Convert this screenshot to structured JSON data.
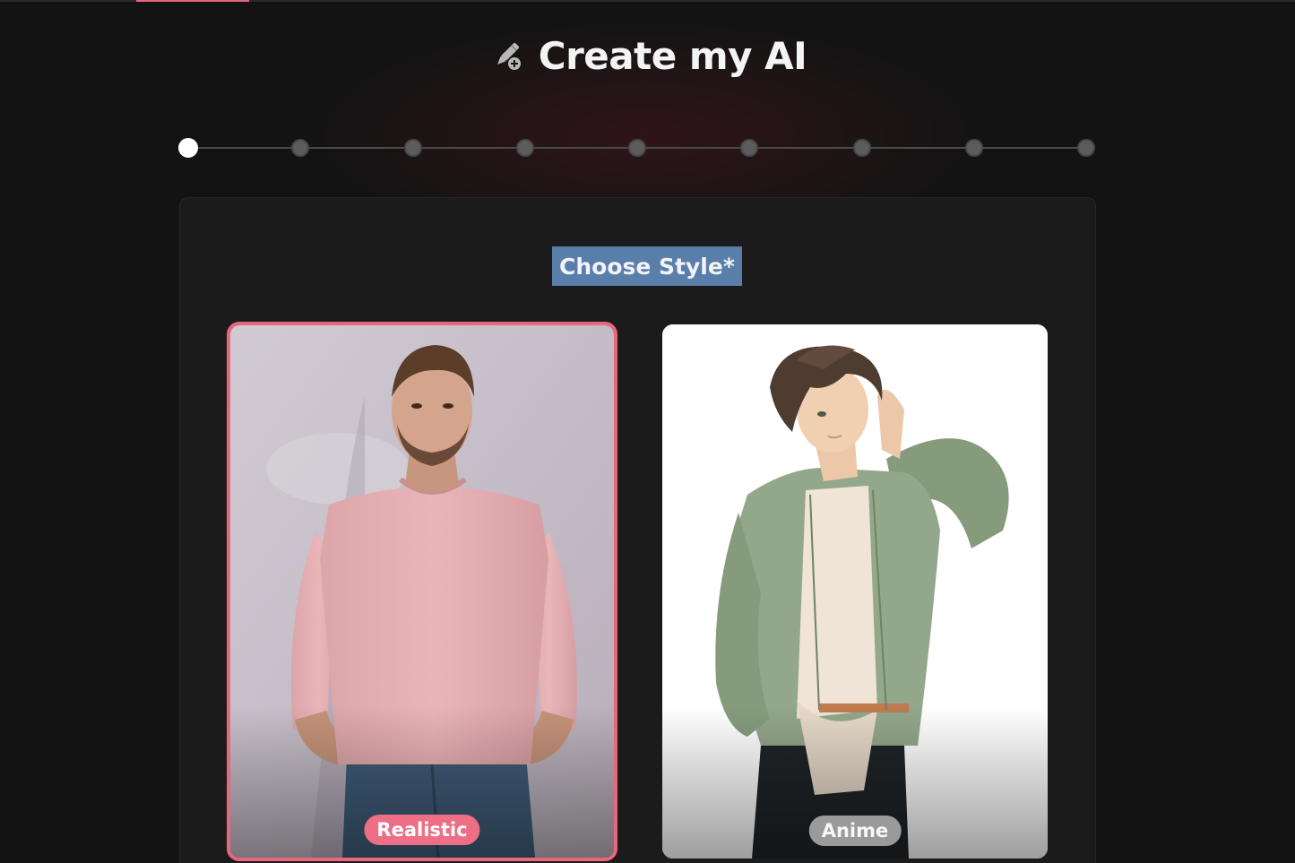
{
  "header": {
    "title": "Create my AI",
    "icon": "pen-plus-icon"
  },
  "stepper": {
    "total_steps": 9,
    "current_step": 1
  },
  "panel": {
    "section_label": "Choose Style*"
  },
  "styles": [
    {
      "label": "Realistic",
      "selected": true,
      "image": "realistic-man-pink-sweater"
    },
    {
      "label": "Anime",
      "selected": false,
      "image": "anime-boy-green-shirt"
    }
  ],
  "colors": {
    "accent": "#e8677e",
    "background": "#131313",
    "panel": "#1b1b1b",
    "selection_highlight": "#5a7eaa"
  }
}
